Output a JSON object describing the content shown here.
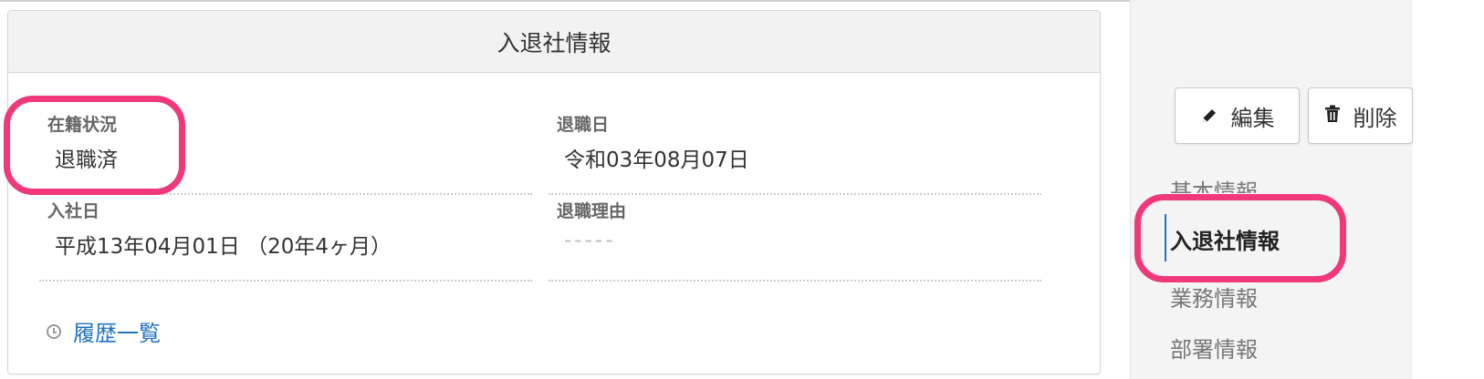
{
  "panel": {
    "title": "入退社情報",
    "fields": {
      "enrollment_status": {
        "label": "在籍状況",
        "value": "退職済"
      },
      "retirement_date": {
        "label": "退職日",
        "value": "令和03年08月07日"
      },
      "hire_date": {
        "label": "入社日",
        "value": "平成13年04月01日 （20年4ヶ月）"
      },
      "retirement_reason": {
        "label": "退職理由",
        "value": "-----"
      }
    },
    "history_link": "履歴一覧"
  },
  "toolbar": {
    "edit_label": "編集",
    "delete_label": "削除"
  },
  "side_nav": {
    "items": [
      {
        "label": "基本情報"
      },
      {
        "label": "入退社情報",
        "active": true
      },
      {
        "label": "業務情報"
      },
      {
        "label": "部署情報"
      }
    ]
  },
  "colors": {
    "accent": "#1f73c3",
    "highlight": "#f0387a"
  }
}
